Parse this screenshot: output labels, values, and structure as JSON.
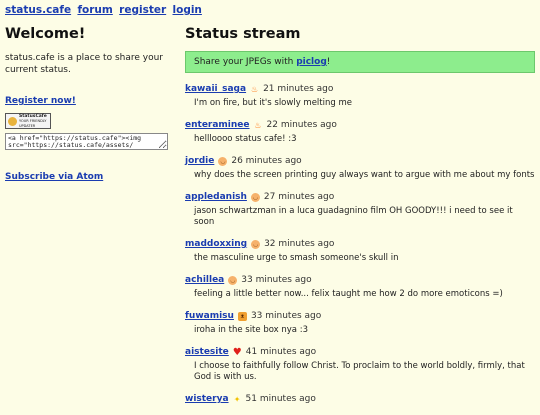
{
  "nav": [
    {
      "label": "status.cafe"
    },
    {
      "label": "forum"
    },
    {
      "label": "register"
    },
    {
      "label": "login"
    }
  ],
  "sidebar": {
    "heading": "Welcome!",
    "intro": "status.cafe is a place to share your current status.",
    "register_link": "Register now!",
    "badge_title": "StatusCafe",
    "badge_sub": "YOUR FRIENDLY UPDATER",
    "embed_code": "<a href=\"https://status.cafe\"><img src=\"https://status.cafe/assets/",
    "atom_link": "Subscribe via Atom"
  },
  "main": {
    "heading": "Status stream",
    "banner_prefix": "Share your JPEGs with ",
    "banner_link": "piclog",
    "banner_suffix": "!"
  },
  "statuses": [
    {
      "user": "kawaii_saga",
      "emoji": "fire",
      "time": "21 minutes ago",
      "text": "I'm on fire, but it's slowly melting me"
    },
    {
      "user": "enteraminee",
      "emoji": "fire",
      "time": "22 minutes ago",
      "text": "hellloooo status cafe! :3"
    },
    {
      "user": "jordie",
      "emoji": "smile",
      "time": "26 minutes ago",
      "text": "why does the screen printing guy always want to argue with me about my fonts"
    },
    {
      "user": "appledanish",
      "emoji": "smile",
      "time": "27 minutes ago",
      "text": "jason schwartzman in a luca guadagnino film OH GOODY!!! i need to see it soon"
    },
    {
      "user": "maddoxxing",
      "emoji": "smile",
      "time": "32 minutes ago",
      "text": "the masculine urge to smash someone's skull in"
    },
    {
      "user": "achillea",
      "emoji": "smile",
      "time": "33 minutes ago",
      "text": "feeling a little better now... felix taught me how 2 do more emoticons =)"
    },
    {
      "user": "fuwamisu",
      "emoji": "cat",
      "time": "33 minutes ago",
      "text": "iroha in the site box nya :3"
    },
    {
      "user": "aistesite",
      "emoji": "heart",
      "time": "41 minutes ago",
      "text": "I choose to faithfully follow Christ. To proclaim to the world boldly, firmly, that God is with us."
    },
    {
      "user": "wisterya",
      "emoji": "sparkle",
      "time": "51 minutes ago",
      "text": ""
    }
  ]
}
